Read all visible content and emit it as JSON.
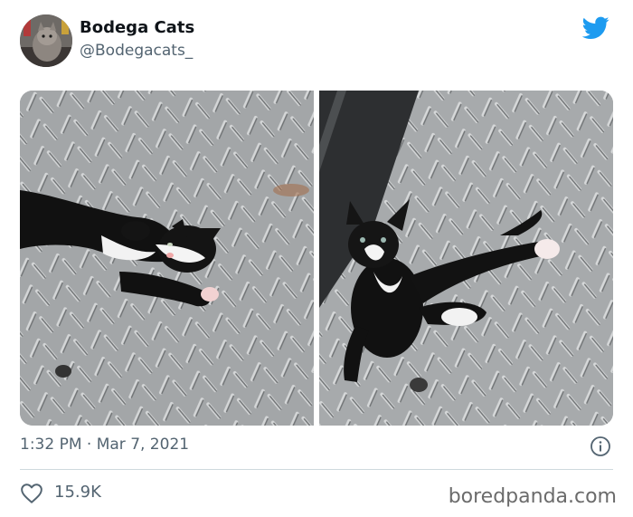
{
  "tweet": {
    "author": {
      "display_name": "Bodega Cats",
      "handle": "@Bodegacats_"
    },
    "timestamp": "1:32 PM · Mar 7, 2021",
    "likes": "15.9K",
    "images": [
      {
        "subject": "black-and-white kitten lying on its side on diamond plate floor"
      },
      {
        "subject": "black-and-white kitten sitting with one leg stretched on diamond plate floor"
      }
    ]
  },
  "watermark": "boredpanda.com",
  "colors": {
    "twitter_blue": "#1d9bf0",
    "secondary_text": "#536471",
    "divider": "#cfd9de"
  },
  "icons": [
    "twitter-bird-icon",
    "info-icon",
    "heart-icon"
  ]
}
